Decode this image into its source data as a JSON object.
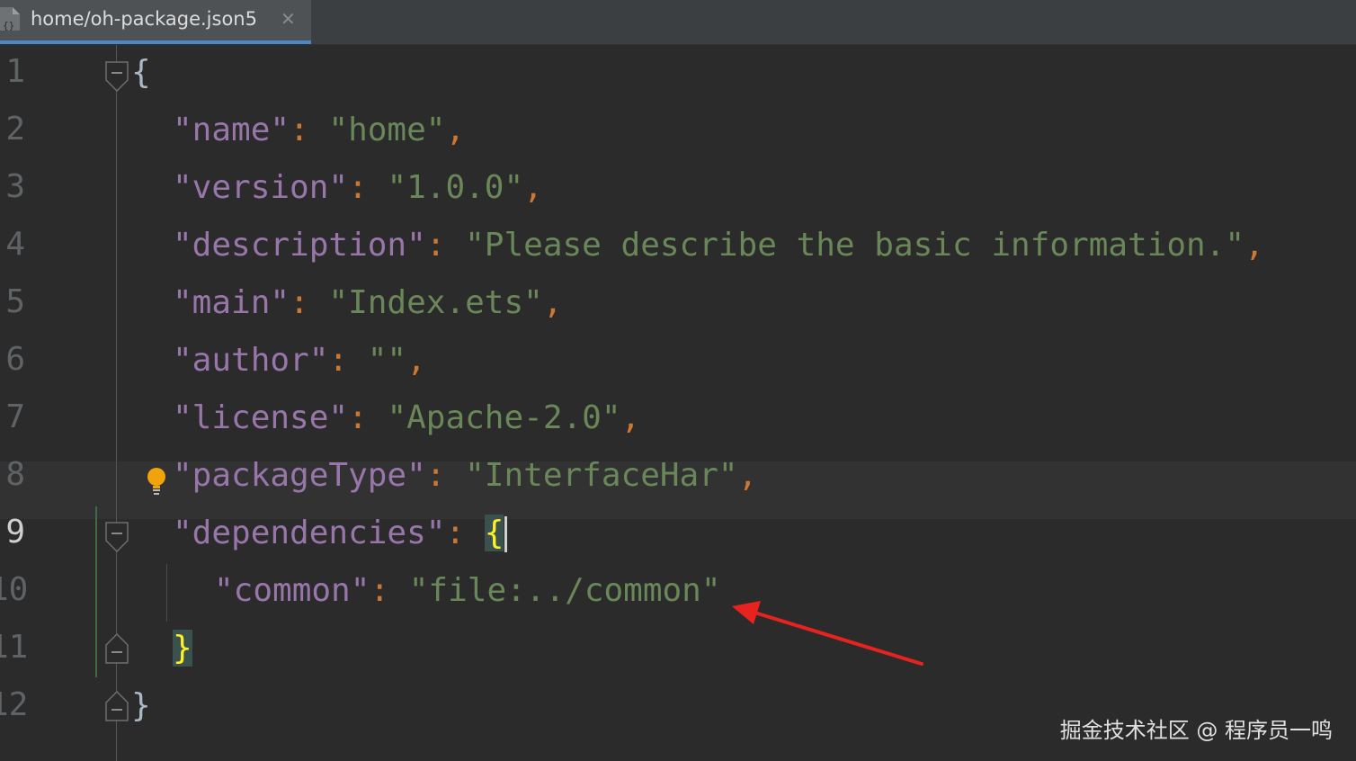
{
  "tab": {
    "title": "home/oh-package.json5",
    "close_icon": "close-icon",
    "file_icon": "json-file-icon",
    "accent": "#4a88c7"
  },
  "gutter": {
    "line_numbers": [
      "1",
      "2",
      "3",
      "4",
      "5",
      "6",
      "7",
      "8",
      "9",
      "10",
      "11",
      "12"
    ],
    "active_line": "9"
  },
  "code": {
    "l1_open": "{",
    "l2_key": "\"name\"",
    "l2_colon": ": ",
    "l2_val": "\"home\"",
    "l2_comma": ",",
    "l3_key": "\"version\"",
    "l3_colon": ": ",
    "l3_val": "\"1.0.0\"",
    "l3_comma": ",",
    "l4_key": "\"description\"",
    "l4_colon": ": ",
    "l4_val": "\"Please describe the basic information.\"",
    "l4_comma": ",",
    "l5_key": "\"main\"",
    "l5_colon": ": ",
    "l5_val": "\"Index.ets\"",
    "l5_comma": ",",
    "l6_key": "\"author\"",
    "l6_colon": ": ",
    "l6_val": "\"\"",
    "l6_comma": ",",
    "l7_key": "\"license\"",
    "l7_colon": ": ",
    "l7_val": "\"Apache-2.0\"",
    "l7_comma": ",",
    "l8_key": "\"packageType\"",
    "l8_colon": ": ",
    "l8_val": "\"InterfaceHar\"",
    "l8_comma": ",",
    "l9_key": "\"dependencies\"",
    "l9_colon": ": ",
    "l9_open": "{",
    "l10_key": "\"common\"",
    "l10_colon": ": ",
    "l10_val": "\"file:../common\"",
    "l11_close": "}",
    "l12_close": "}"
  },
  "colors": {
    "key": "#9876aa",
    "string": "#6a8759",
    "punctuation": "#cc7832",
    "brace_match": "#ffef28",
    "annotation_arrow": "#e8231f"
  },
  "icons": {
    "intention": "lightbulb-icon",
    "fold": "fold-marker-icon"
  },
  "watermark": "掘金技术社区 @ 程序员一鸣"
}
